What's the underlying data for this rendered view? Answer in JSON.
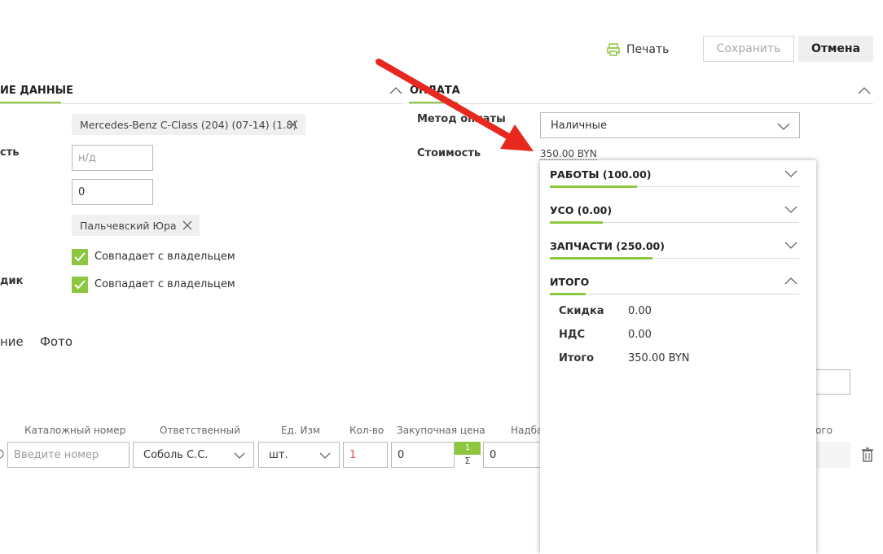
{
  "toolbar": {
    "print_label": "Печать",
    "save_label": "Сохранить",
    "cancel_label": "Отмена"
  },
  "left": {
    "section_title": "ИЕ ДАННЫЕ",
    "labels": {
      "l1": "сть",
      "l2": "дик"
    },
    "car_chip": "Mercedes-Benz C-Class (204) (07-14) (1.8)",
    "mileage_placeholder": "н/д",
    "number_value": "0",
    "person_chip": "Пальчевский Юра",
    "same_owner_1": "Совпадает с владельцем",
    "same_owner_2": "Совпадает с владельцем",
    "tabs": {
      "partial": "ние",
      "photo": "Фото"
    }
  },
  "payment": {
    "section_title": "ОПЛАТА",
    "method_label": "Метод оплаты",
    "method_value": "Наличные",
    "cost_label": "Стоимость",
    "cost_value": "350.00 BYN"
  },
  "popover": {
    "sections": [
      {
        "title": "РАБОТЫ (100.00)"
      },
      {
        "title": "УСО (0.00)"
      },
      {
        "title": "ЗАПЧАСТИ (250.00)"
      },
      {
        "title": "ИТОГО"
      }
    ],
    "totals": [
      {
        "label": "Скидка",
        "value": "0.00"
      },
      {
        "label": "НДС",
        "value": "0.00"
      },
      {
        "label": "Итого",
        "value": "350.00 BYN"
      }
    ]
  },
  "table": {
    "headers": {
      "catalog": "Каталожный номер",
      "responsible": "Ответственный",
      "unit": "Ед. Изм",
      "qty": "Кол-во",
      "purchase": "Закупочная цена",
      "markup": "Надба",
      "total_partial": "ого"
    },
    "row": {
      "catalog_placeholder": "Введите номер",
      "responsible": "Соболь С.С.",
      "unit": "шт.",
      "qty": "1",
      "purchase": "0",
      "badge_top": "1",
      "badge_bottom": "Σ",
      "markup": "0"
    }
  },
  "colors": {
    "accent": "#8dc63f",
    "arrow": "#e8281e"
  }
}
